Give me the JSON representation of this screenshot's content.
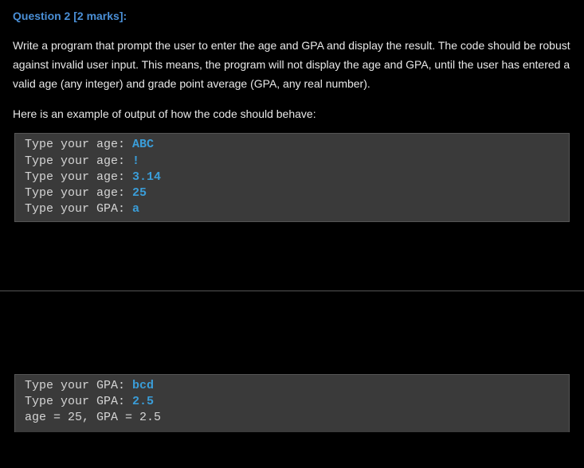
{
  "question": {
    "title": "Question 2 [2 marks]:",
    "description": "Write a program that prompt the user to enter the age and GPA and display the result. The code should be robust against invalid user input. This means, the program will not display the age and GPA, until the user has entered a valid age (any integer) and grade point average (GPA, any real number).",
    "subheading": "Here is an example of output of how the code should behave:"
  },
  "codeBlock1": {
    "line1": {
      "prompt": "Type your age: ",
      "input": "ABC"
    },
    "line2": {
      "prompt": "Type your age: ",
      "input": "!"
    },
    "line3": {
      "prompt": "Type your age: ",
      "input": "3.14"
    },
    "line4": {
      "prompt": "Type your age: ",
      "input": "25"
    },
    "line5": {
      "prompt": "Type your GPA: ",
      "input": "a"
    }
  },
  "codeBlock2": {
    "line1": {
      "prompt": "Type your GPA: ",
      "input": "bcd"
    },
    "line2": {
      "prompt": "Type your GPA: ",
      "input": "2.5"
    },
    "line3": {
      "result": "age = 25, GPA = 2.5"
    }
  }
}
